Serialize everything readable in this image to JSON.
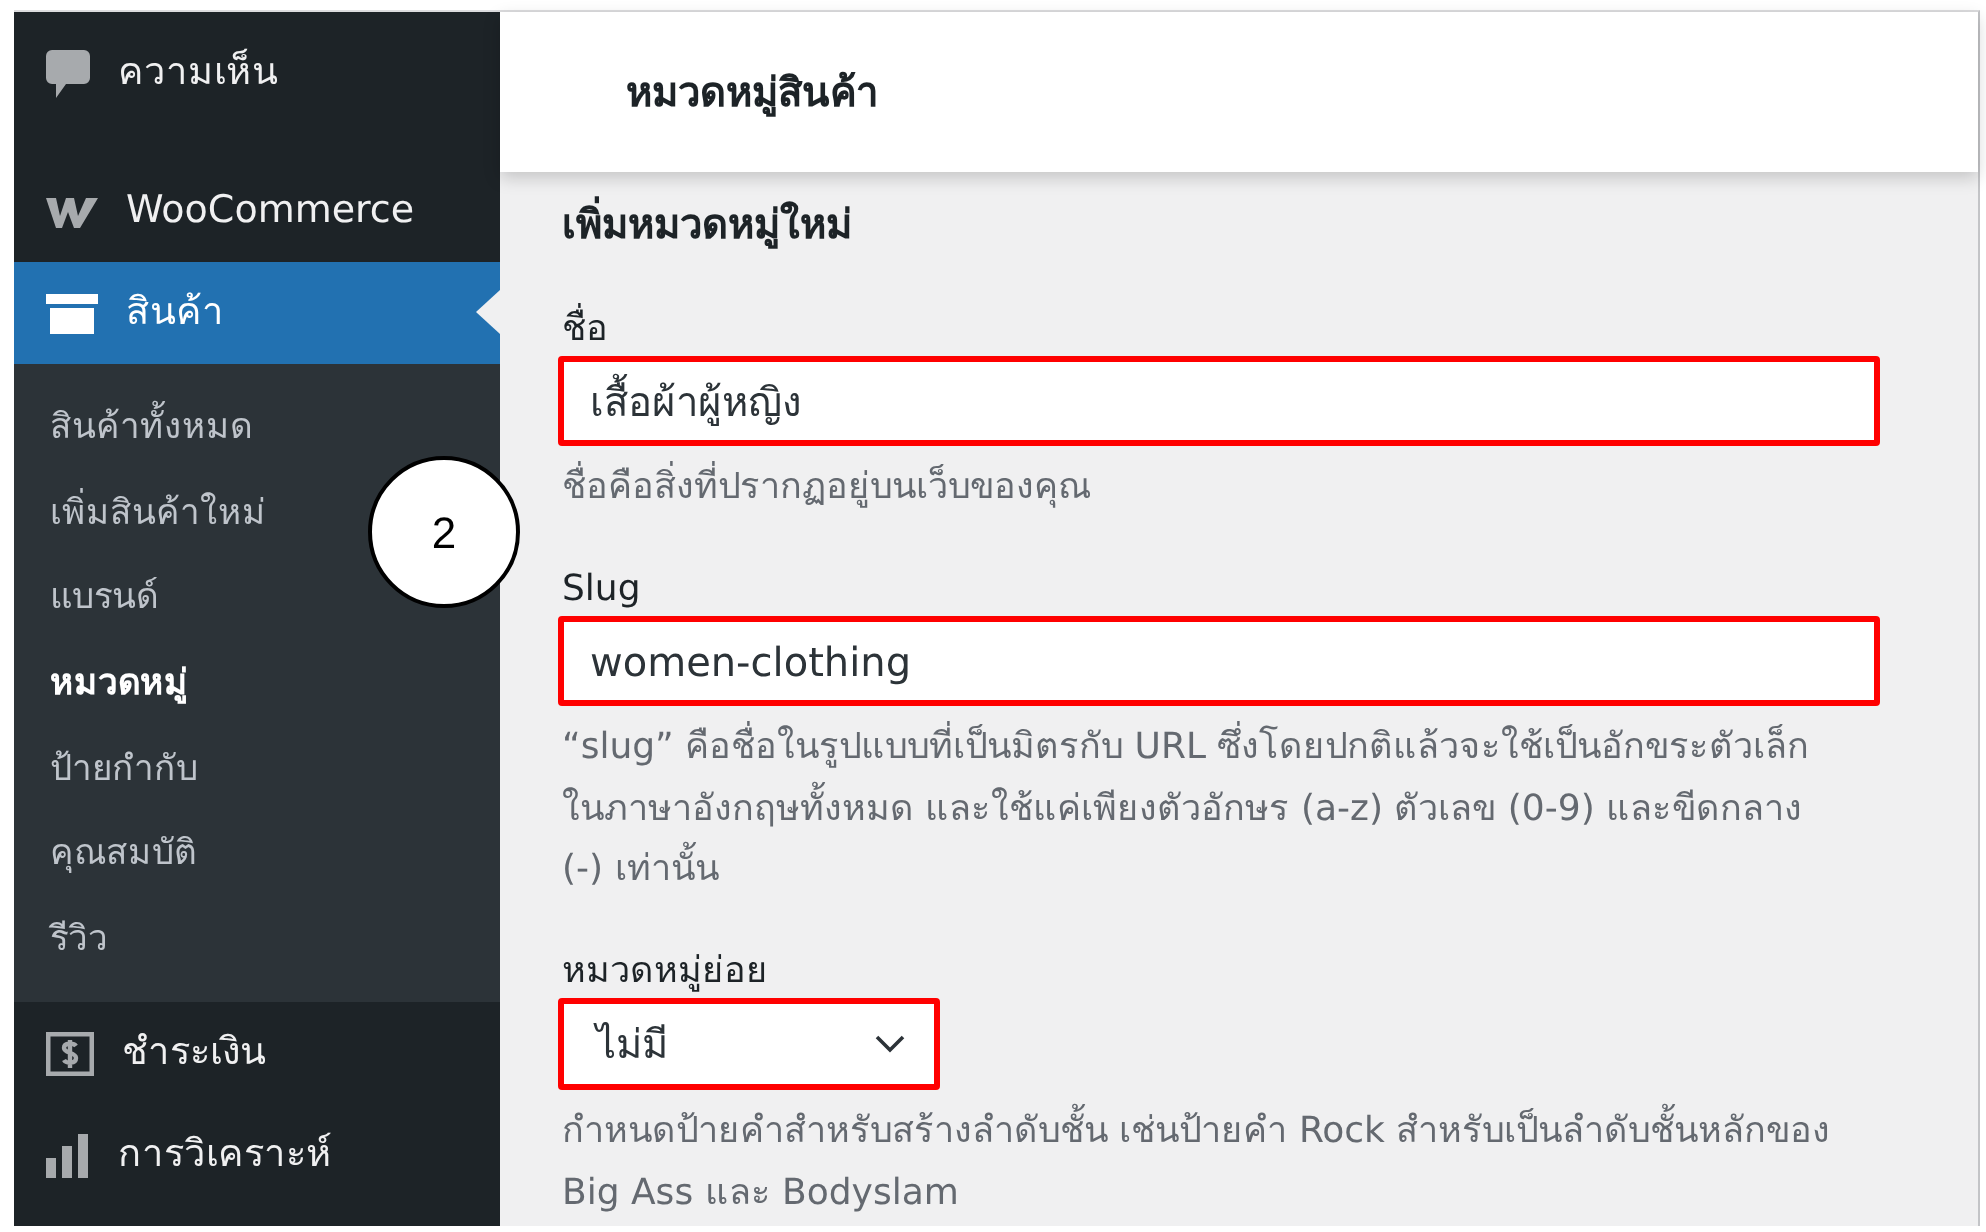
{
  "sidebar": {
    "items": [
      {
        "label": "ความเห็น",
        "selected": false
      },
      {
        "label": "WooCommerce",
        "selected": false
      },
      {
        "label": "สินค้า",
        "selected": true,
        "children": [
          {
            "label": "สินค้าทั้งหมด",
            "selected": false
          },
          {
            "label": "เพิ่มสินค้าใหม่",
            "selected": false
          },
          {
            "label": "แบรนด์",
            "selected": false
          },
          {
            "label": "หมวดหมู่",
            "selected": true
          },
          {
            "label": "ป้ายกำกับ",
            "selected": false
          },
          {
            "label": "คุณสมบัติ",
            "selected": false
          },
          {
            "label": "รีวิว",
            "selected": false
          }
        ]
      },
      {
        "label": "ชำระเงิน",
        "selected": false
      },
      {
        "label": "การวิเคราะห์",
        "selected": false
      }
    ]
  },
  "header": {
    "title": "หมวดหมู่สินค้า"
  },
  "form": {
    "heading": "เพิ่มหมวดหมู่ใหม่",
    "fields": [
      {
        "kind": "text",
        "label": "ชื่อ",
        "value": "เสื้อผ้าผู้หญิง",
        "highlighted": true,
        "hint": "ชื่อคือสิ่งที่ปรากฏอยู่บนเว็บของคุณ"
      },
      {
        "kind": "text",
        "label": "Slug",
        "value": "women-clothing",
        "highlighted": true,
        "hint": "“slug” คือชื่อในรูปแบบที่เป็นมิตรกับ URL ซึ่งโดยปกติแล้วจะใช้เป็นอักขระตัวเล็กในภาษาอังกฤษทั้งหมด และใช้แค่เพียงตัวอักษร (a-z) ตัวเลข (0-9) และขีดกลาง (-) เท่านั้น"
      },
      {
        "kind": "select",
        "label": "หมวดหมู่ย่อย",
        "value": "ไม่มี",
        "highlighted": true,
        "hint": "กำหนดป้ายคำสำหรับสร้างลำดับชั้น เช่นป้ายคำ Rock สำหรับเป็นลำดับชั้นหลักของ Big Ass และ Bodyslam"
      }
    ]
  },
  "annotation": {
    "label": "2"
  }
}
